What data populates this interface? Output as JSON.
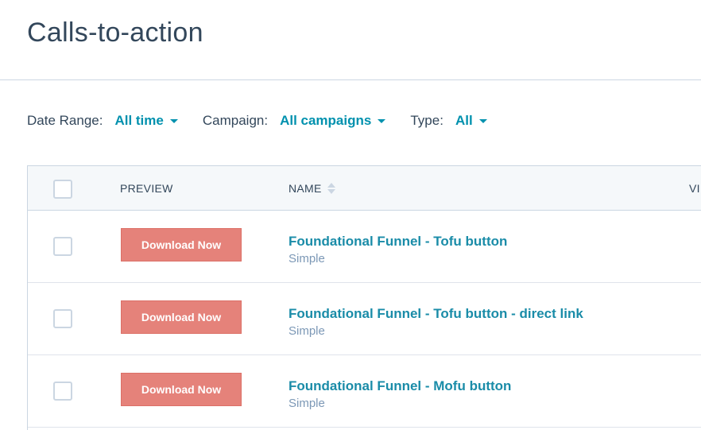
{
  "page": {
    "title": "Calls-to-action"
  },
  "filters": {
    "date_range": {
      "label": "Date Range:",
      "value": "All time"
    },
    "campaign": {
      "label": "Campaign:",
      "value": "All campaigns"
    },
    "type": {
      "label": "Type:",
      "value": "All"
    }
  },
  "table": {
    "columns": {
      "preview": "PREVIEW",
      "name": "NAME",
      "views": "VI"
    },
    "rows": [
      {
        "preview_label": "Download Now",
        "name": "Foundational Funnel - Tofu button",
        "type": "Simple"
      },
      {
        "preview_label": "Download Now",
        "name": "Foundational Funnel - Tofu button - direct link",
        "type": "Simple"
      },
      {
        "preview_label": "Download Now",
        "name": "Foundational Funnel - Mofu button",
        "type": "Simple"
      }
    ]
  },
  "colors": {
    "link": "#0091ae",
    "cta_button": "#e5827a",
    "text": "#33475b",
    "muted": "#7c98b6",
    "header_bg": "#f5f8fa"
  }
}
